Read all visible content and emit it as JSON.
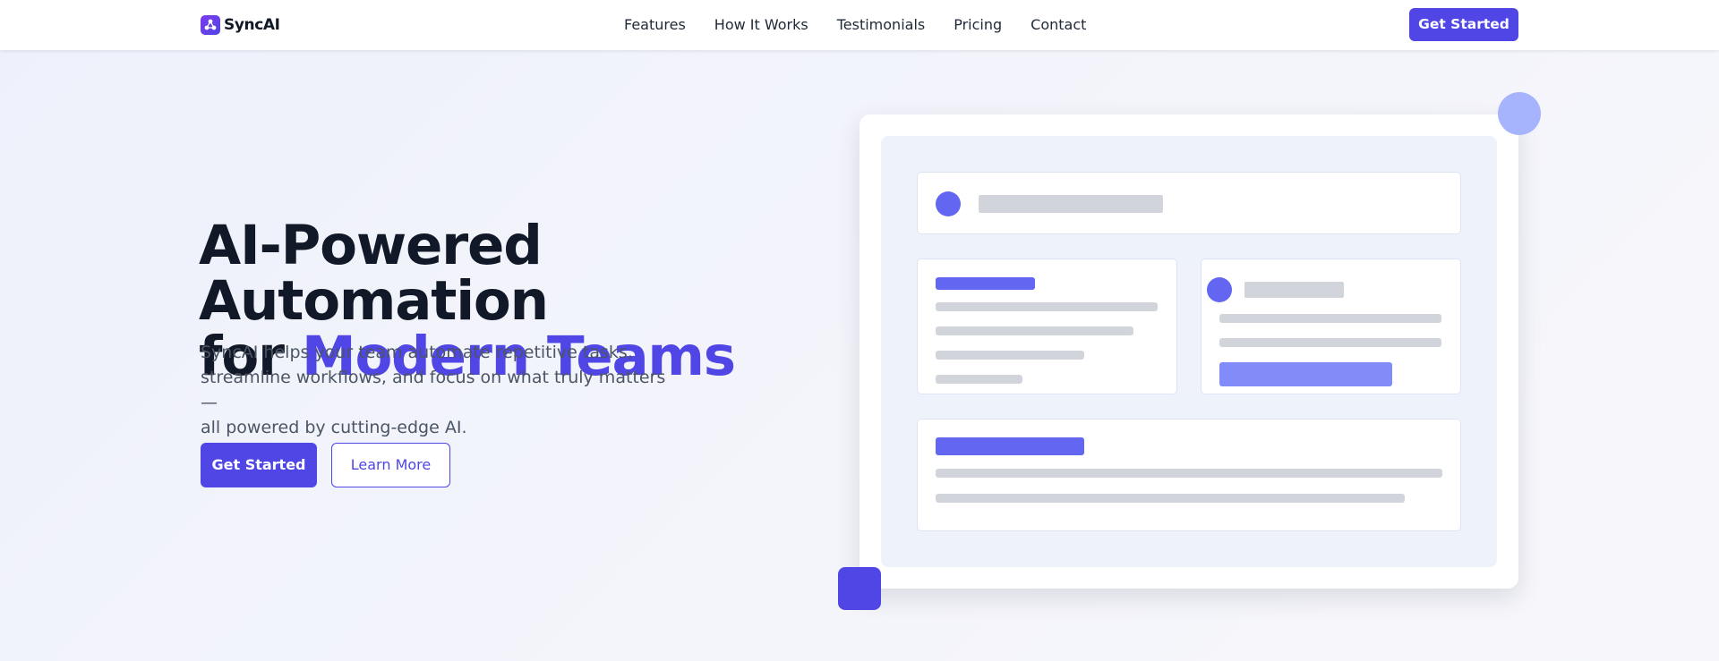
{
  "brand": {
    "name": "SyncAI",
    "accent": "#4f46e5",
    "accent_light": "#a5b4fc"
  },
  "nav": {
    "links": [
      "Features",
      "How It Works",
      "Testimonials",
      "Pricing",
      "Contact"
    ],
    "cta": "Get Started"
  },
  "hero": {
    "title_line1": "AI-Powered Automation",
    "title_line2_prefix": "for ",
    "title_line2_accent": "Modern Teams",
    "subtitle_line1": "SyncAI helps your team automate repetitive tasks,",
    "subtitle_line2": "streamline workflows, and focus on what truly matters—",
    "subtitle_line3": "all powered by cutting-edge AI.",
    "primary_button": "Get Started",
    "secondary_button": "Learn More"
  },
  "mockup": {
    "icons": [
      "logo-icon",
      "avatar-placeholder-icon"
    ]
  }
}
